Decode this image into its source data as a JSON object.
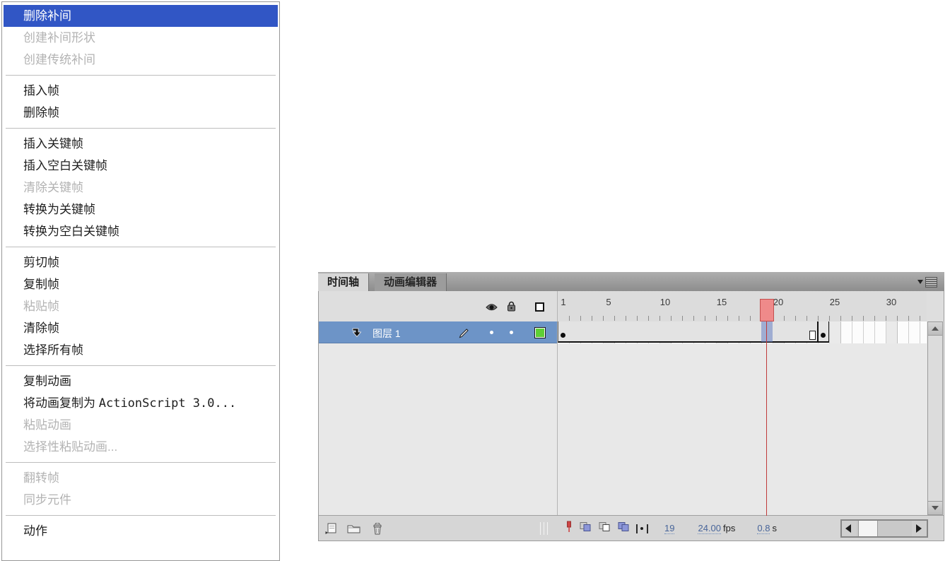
{
  "context_menu": {
    "items": [
      {
        "label": "删除补间",
        "state": "selected"
      },
      {
        "label": "创建补间形状",
        "state": "disabled"
      },
      {
        "label": "创建传统补间",
        "state": "disabled"
      },
      {
        "separator": true
      },
      {
        "label": "插入帧",
        "state": "normal"
      },
      {
        "label": "删除帧",
        "state": "normal"
      },
      {
        "separator": true
      },
      {
        "label": "插入关键帧",
        "state": "normal"
      },
      {
        "label": "插入空白关键帧",
        "state": "normal"
      },
      {
        "label": "清除关键帧",
        "state": "disabled"
      },
      {
        "label": "转换为关键帧",
        "state": "normal"
      },
      {
        "label": "转换为空白关键帧",
        "state": "normal"
      },
      {
        "separator": true
      },
      {
        "label": "剪切帧",
        "state": "normal"
      },
      {
        "label": "复制帧",
        "state": "normal"
      },
      {
        "label": "粘贴帧",
        "state": "disabled"
      },
      {
        "label": "清除帧",
        "state": "normal"
      },
      {
        "label": "选择所有帧",
        "state": "normal"
      },
      {
        "separator": true
      },
      {
        "label": "复制动画",
        "state": "normal"
      },
      {
        "label": "将动画复制为 ActionScript 3.0...",
        "state": "normal",
        "parts": [
          {
            "text": "将动画复制为 "
          },
          {
            "text": "ActionScript 3.0...",
            "mono": true
          }
        ]
      },
      {
        "label": "粘贴动画",
        "state": "disabled"
      },
      {
        "label": "选择性粘贴动画...",
        "state": "disabled"
      },
      {
        "separator": true
      },
      {
        "label": "翻转帧",
        "state": "disabled"
      },
      {
        "label": "同步元件",
        "state": "disabled"
      },
      {
        "separator": true
      },
      {
        "label": "动作",
        "state": "normal"
      }
    ]
  },
  "timeline": {
    "tabs": [
      {
        "label": "时间轴",
        "active": true
      },
      {
        "label": "动画编辑器",
        "active": false
      }
    ],
    "header_icons": [
      "eye-icon",
      "lock-icon",
      "outline-icon"
    ],
    "layer": {
      "name": "图层 1",
      "selected": true,
      "outline_color": "#5ecf35"
    },
    "ruler": {
      "numbers": [
        1,
        5,
        10,
        15,
        20,
        25,
        30
      ]
    },
    "frames": {
      "keyframes": [
        1,
        24
      ],
      "span_end": 23,
      "playhead": 19
    },
    "bottom_bar": {
      "icons": [
        "new-layer-icon",
        "new-folder-icon",
        "delete-layer-icon",
        "center-frame-icon",
        "onion-skin-icon",
        "onion-skin-outlines-icon",
        "edit-multiple-frames-icon",
        "modify-markers-icon"
      ],
      "current_frame": "19",
      "frame_rate": "24.00",
      "frame_rate_unit": "fps",
      "elapsed_time": "0.8",
      "elapsed_unit": "s"
    }
  },
  "colors": {
    "menu_highlight": "#3156c5",
    "layer_selected": "#6d94c7",
    "playhead_red": "#ef8a8a",
    "status_link": "#48659a",
    "outline_square_green": "#5ecf35"
  }
}
